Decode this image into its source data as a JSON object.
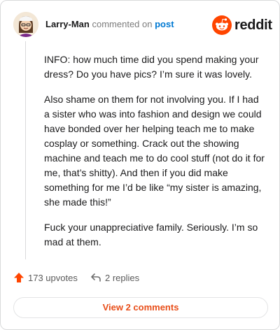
{
  "header": {
    "username": "Larry-Man",
    "action_text": "commented on",
    "post_link": "post",
    "brand": "reddit"
  },
  "comment": {
    "paragraphs": [
      "INFO: how much time did you spend making your dress? Do you have pics? I’m sure it was lovely.",
      "Also shame on them for not involving you. If I had a sister who was into fashion and design we could have bonded over her helping teach me to make cosplay or something. Crack out the showing machine and teach me to do cool stuff (not do it for me, that’s shitty). And then if you did make something for me I’d be like “my sister is amazing, she made this!”",
      "Fuck your unappreciative family. Seriously. I’m so mad at them."
    ]
  },
  "actions": {
    "upvotes": "173 upvotes",
    "replies": "2 replies",
    "view_comments": "View 2 comments"
  },
  "colors": {
    "brand": "#ff4500",
    "link": "#0079d3",
    "button_text": "#e84e19"
  }
}
